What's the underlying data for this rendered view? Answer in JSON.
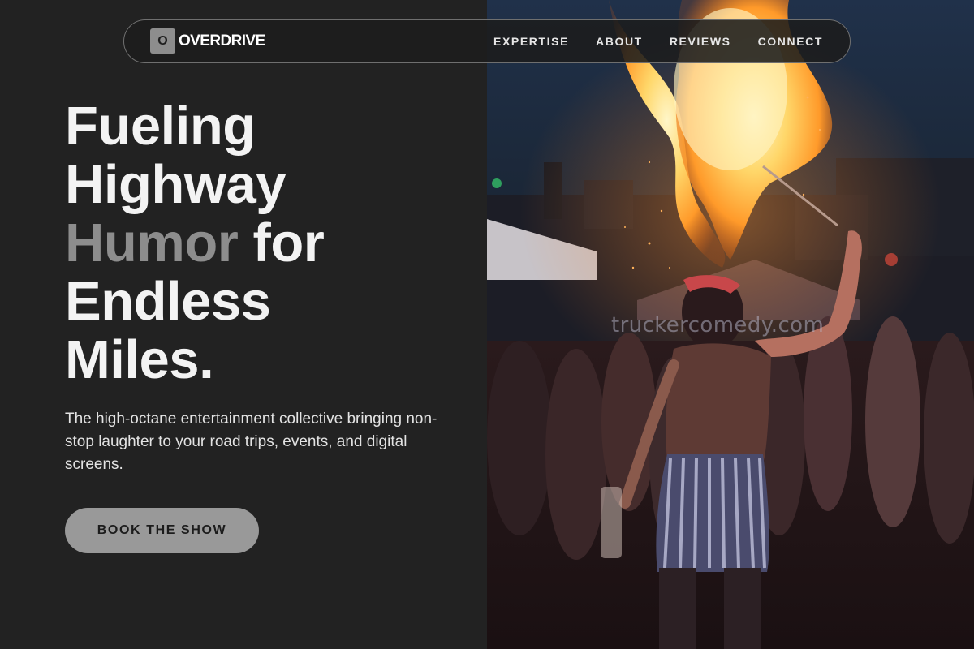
{
  "brand": {
    "logo_letter": "O",
    "name": "OVERDRIVE"
  },
  "nav": {
    "items": [
      "EXPERTISE",
      "ABOUT",
      "REVIEWS",
      "CONNECT"
    ]
  },
  "hero": {
    "title_line1": "Fueling",
    "title_line2": "Highway",
    "title_line3_muted": "Humor",
    "title_line3_rest": " for",
    "title_line4": "Endless",
    "title_line5": "Miles.",
    "description": "The high-octane entertainment collective bringing non-stop laughter to your road trips, events, and digital screens.",
    "cta_label": "BOOK THE SHOW"
  },
  "photo": {
    "watermark": "truckercomedy.com"
  },
  "colors": {
    "panel_bg": "#222222",
    "accent_muted": "#8d8d8d",
    "cta_bg": "#999999",
    "text": "#f3f3f3"
  }
}
